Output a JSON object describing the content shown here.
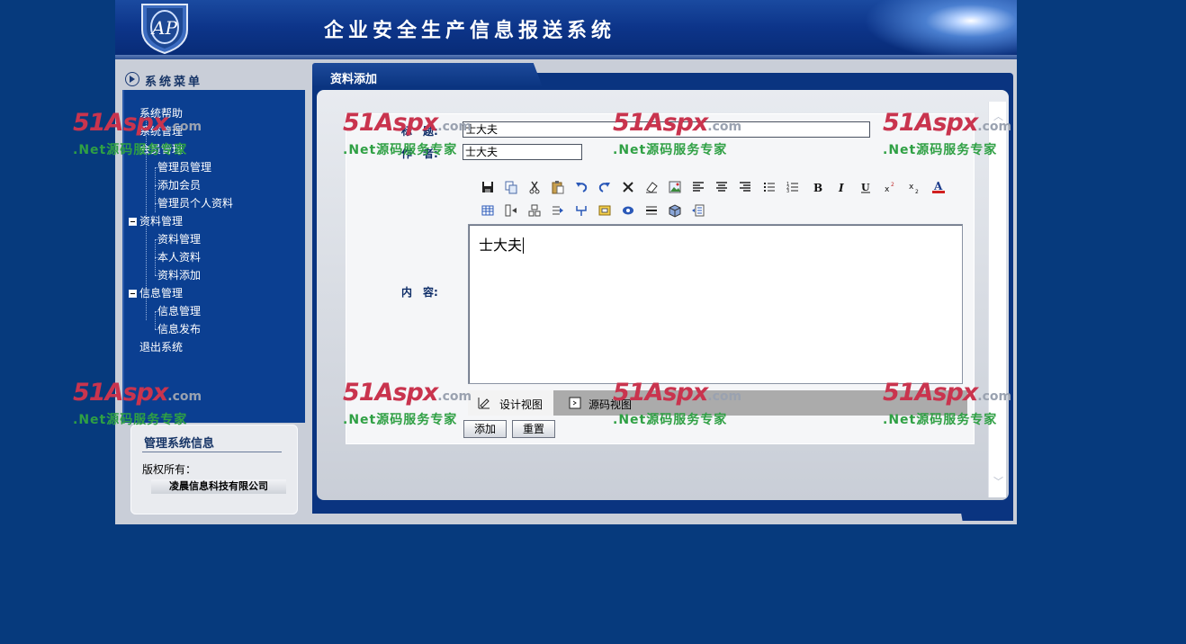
{
  "header": {
    "title": "企业安全生产信息报送系统",
    "logo_text": "AP"
  },
  "sidebar": {
    "title": "系统菜单",
    "items": [
      {
        "label": "系统帮助"
      },
      {
        "label": "系统管理"
      },
      {
        "label": "会员管理"
      },
      {
        "label": "管理员管理"
      },
      {
        "label": "添加会员"
      },
      {
        "label": "管理员个人资料"
      },
      {
        "label": "资料管理"
      },
      {
        "label": "资料管理"
      },
      {
        "label": "本人资料"
      },
      {
        "label": "资料添加"
      },
      {
        "label": "信息管理"
      },
      {
        "label": "信息管理"
      },
      {
        "label": "信息发布"
      },
      {
        "label": "退出系统"
      }
    ],
    "info": {
      "title": "管理系统信息",
      "copyright_label": "版权所有：",
      "company": "凌晨信息科技有限公司"
    }
  },
  "main": {
    "tab_label": "资料添加",
    "form": {
      "title_label": "标　题:",
      "title_value": "士大夫",
      "author_label": "作　者:",
      "author_value": "士大夫",
      "content_label": "内　容:",
      "editor_content": "士大夫",
      "mode_design": "设计视图",
      "mode_source": "源码视图",
      "submit_label": "添加",
      "reset_label": "重置"
    }
  },
  "watermark": {
    "logo_51": "51",
    "logo_aspx": "Aspx",
    "logo_com": ".com",
    "tagline": ".Net源码服务专家"
  },
  "colors": {
    "page_bg": "#063a7d",
    "panel_bg": "#c9ced8",
    "nav_bg": "#0b3f91",
    "label_color": "#0d2c67",
    "watermark_red": "#c9344e",
    "watermark_green": "#2fa044"
  }
}
